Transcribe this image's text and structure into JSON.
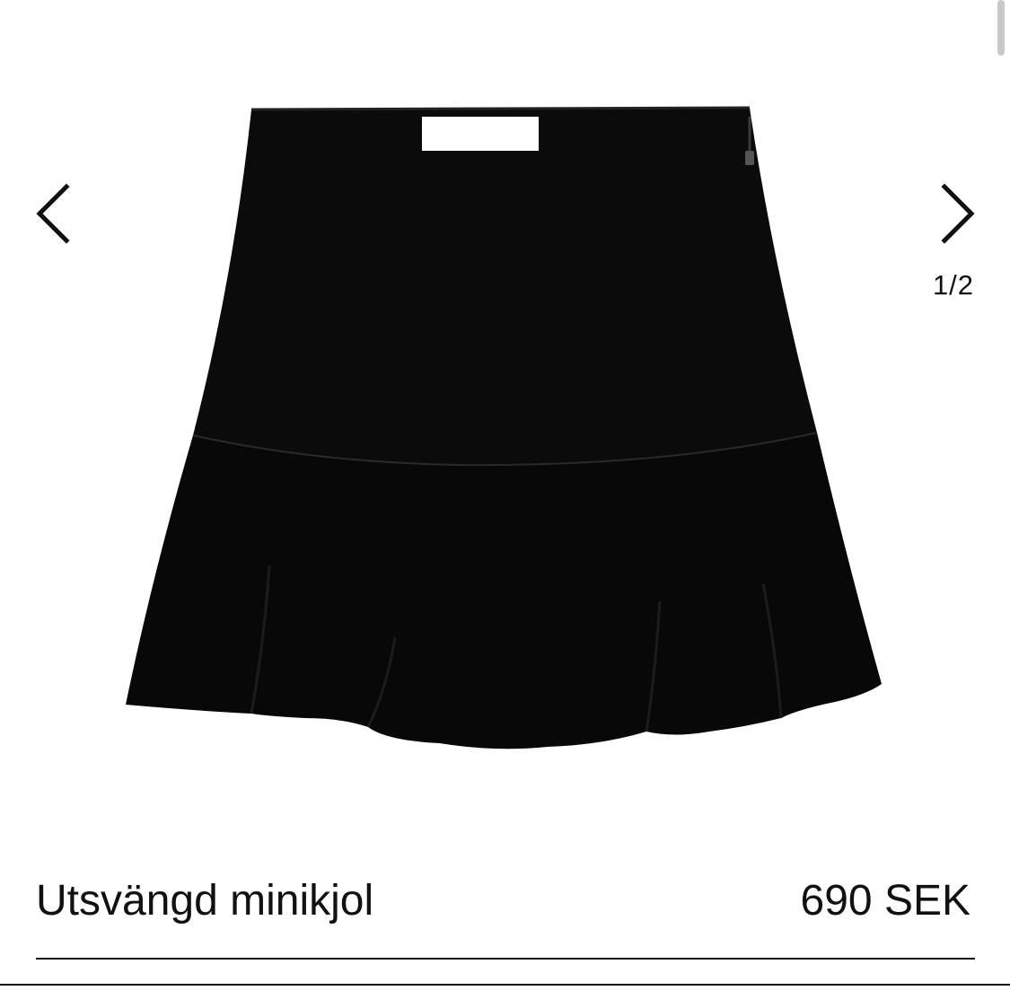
{
  "gallery": {
    "image_alt": "Utsvängd minikjol",
    "counter": "1/2",
    "prev_icon": "chevron-left-icon",
    "next_icon": "chevron-right-icon"
  },
  "product": {
    "name": "Utsvängd minikjol",
    "price": "690 SEK",
    "color": "#0a0a0a"
  }
}
